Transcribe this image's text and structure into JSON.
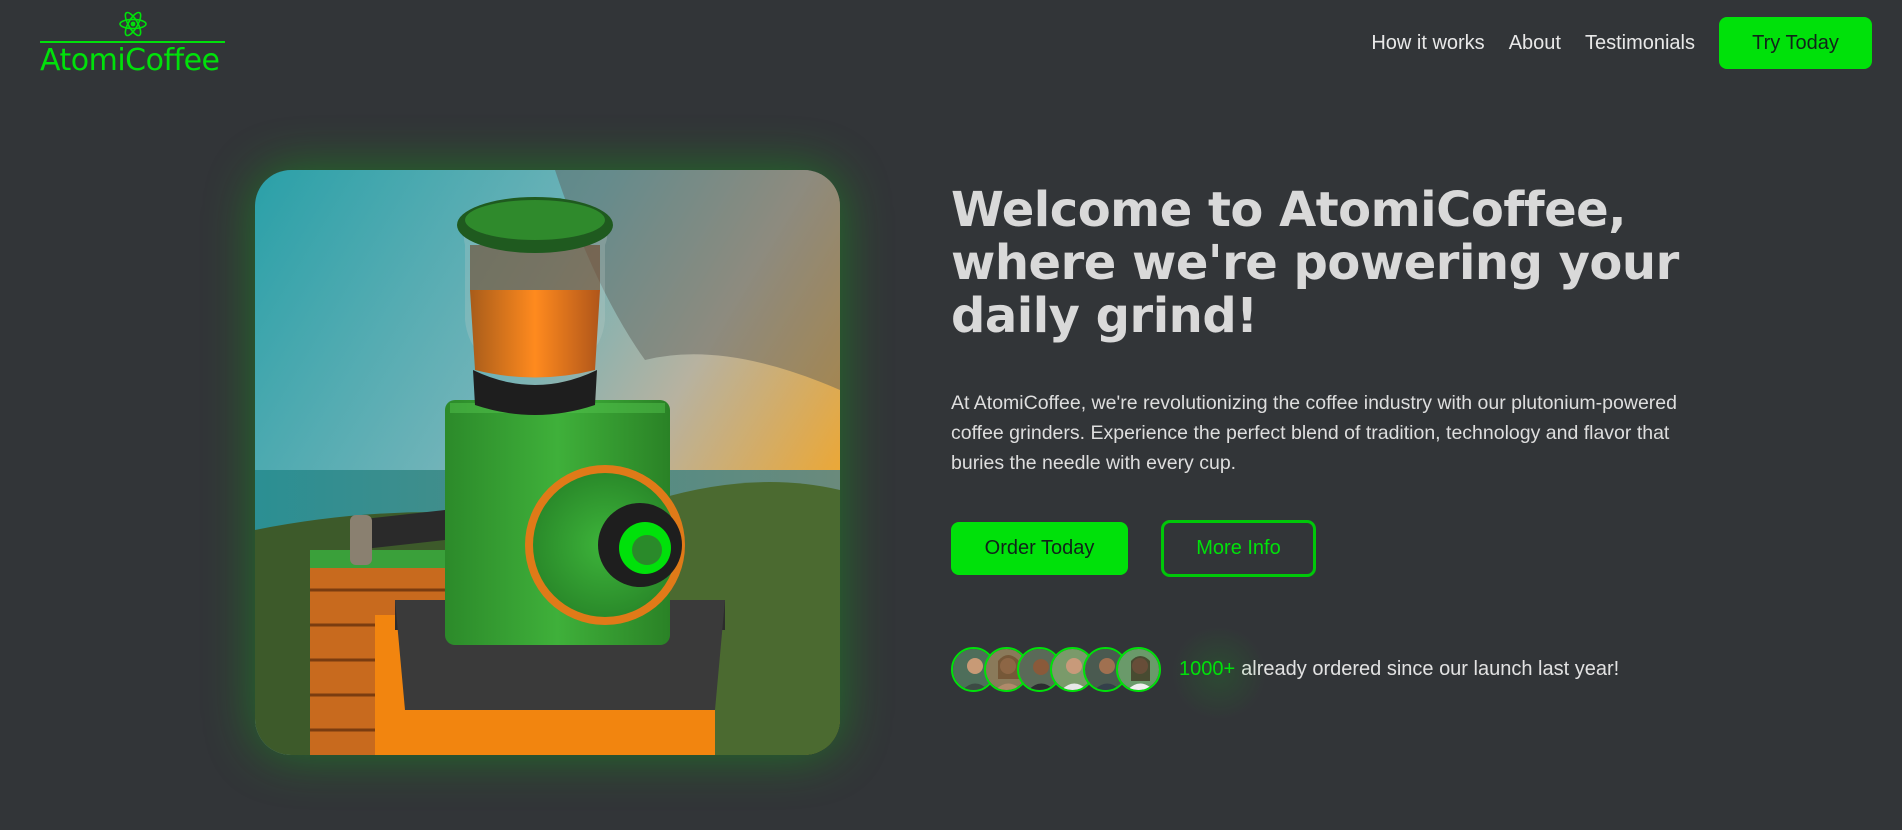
{
  "brand": {
    "name": "AtomiCoffee",
    "icon": "atom-icon",
    "accent": "#00e10a"
  },
  "nav": {
    "links": [
      "How it works",
      "About",
      "Testimonials"
    ],
    "cta_label": "Try Today"
  },
  "hero": {
    "title": "Welcome to AtomiCoffee, where we're powering your daily grind!",
    "description": "At AtomiCoffee, we're revolutionizing the coffee industry with our plutonium-powered coffee grinders. Experience the perfect blend of tradition, technology and flavor that buries the needle with every cup.",
    "image": "green-coffee-grinder-photo",
    "primary_button": "Order Today",
    "secondary_button": "More Info"
  },
  "social_proof": {
    "count": "1000+",
    "text": "already ordered since our launch last year!",
    "avatars": [
      "customer-avatar-1",
      "customer-avatar-2",
      "customer-avatar-3",
      "customer-avatar-4",
      "customer-avatar-5",
      "customer-avatar-6"
    ]
  },
  "colors": {
    "background": "#323538",
    "accent": "#00e10a",
    "heading": "#d9d9d9"
  }
}
